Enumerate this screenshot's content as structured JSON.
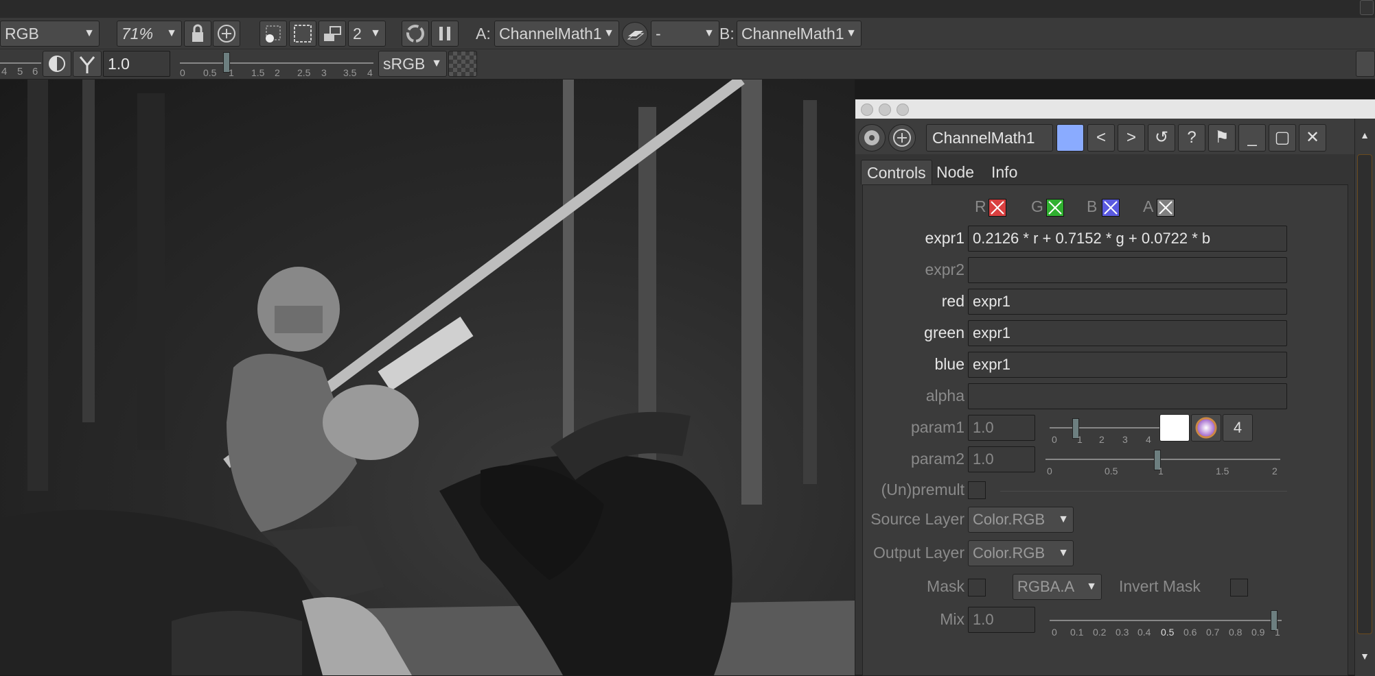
{
  "toolbar": {
    "channels": "RGB",
    "zoom": "71%",
    "frame_count": "2",
    "a_label": "A:",
    "a_input": "ChannelMath1",
    "mode": "-",
    "b_label": "B:",
    "b_input": "ChannelMath1",
    "gain_ticks": [
      "4",
      "5",
      "6"
    ],
    "gamma_value": "1.0",
    "gamma_ticks": [
      "0",
      "0.5",
      "1",
      "1.5",
      "2",
      "2.5",
      "3",
      "3.5",
      "4"
    ],
    "colorspace": "sRGB"
  },
  "panel": {
    "node_name": "ChannelMath1",
    "tabs": [
      "Controls",
      "Node",
      "Info"
    ],
    "channels": {
      "r": "R",
      "g": "G",
      "b": "B",
      "a": "A",
      "r_color": "#d94040",
      "g_color": "#30b030",
      "b_color": "#5a5ae0",
      "a_color": "#808080"
    },
    "expr1_label": "expr1",
    "expr1_value": "0.2126 * r + 0.7152 * g + 0.0722 * b",
    "expr2_label": "expr2",
    "expr2_value": "",
    "red_label": "red",
    "red_value": "expr1",
    "green_label": "green",
    "green_value": "expr1",
    "blue_label": "blue",
    "blue_value": "expr1",
    "alpha_label": "alpha",
    "alpha_value": "",
    "param1_label": "param1",
    "param1_value": "1.0",
    "param1_ticks": [
      "0",
      "1",
      "2",
      "3",
      "4"
    ],
    "param1_dims": "4",
    "param2_label": "param2",
    "param2_value": "1.0",
    "param2_ticks": [
      "0",
      "0.5",
      "1",
      "1.5",
      "2"
    ],
    "unpremult_label": "(Un)premult",
    "source_layer_label": "Source Layer",
    "source_layer_value": "Color.RGB",
    "output_layer_label": "Output Layer",
    "output_layer_value": "Color.RGB",
    "mask_label": "Mask",
    "mask_channel": "RGBA.A",
    "invert_mask_label": "Invert Mask",
    "mix_label": "Mix",
    "mix_value": "1.0",
    "mix_ticks": [
      "0",
      "0.1",
      "0.2",
      "0.3",
      "0.4",
      "0.5",
      "0.6",
      "0.7",
      "0.8",
      "0.9",
      "1"
    ]
  }
}
